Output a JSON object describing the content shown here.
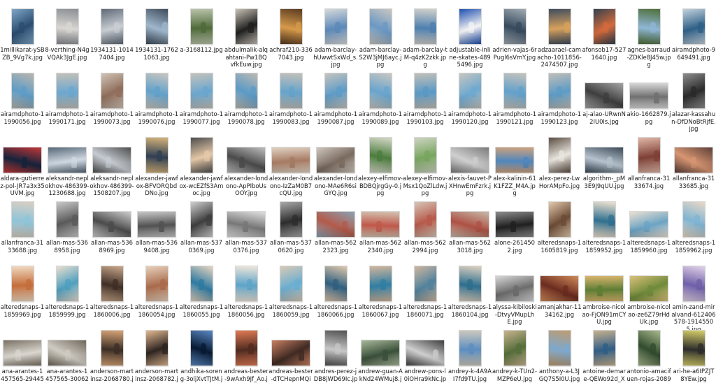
{
  "explorer": {
    "view": "large-icons",
    "files": [
      {
        "name": "1millikarat-ySBZB_9Vg7k.jpg",
        "orientation": "portrait",
        "palette": [
          "#2b4c6f",
          "#7fa7c8"
        ]
      },
      {
        "name": "8-verthing-N4gVQAk3JgE.jpg",
        "orientation": "portrait",
        "palette": [
          "#d9d7d2",
          "#8b8e94"
        ]
      },
      {
        "name": "1934131-10147404.jpg",
        "orientation": "portrait",
        "palette": [
          "#c9ced3",
          "#5f6a78"
        ]
      },
      {
        "name": "1934131-17621063.jpg",
        "orientation": "portrait",
        "palette": [
          "#9fb7cc",
          "#3e4c5b"
        ]
      },
      {
        "name": "a-3168112.jpg",
        "orientation": "portrait",
        "palette": [
          "#4e6a3a",
          "#b8c2a8"
        ]
      },
      {
        "name": "abdulmalik-alqahtani-Pw1BQvfkEuw.jpg",
        "orientation": "portrait",
        "palette": [
          "#1f1f1f",
          "#c9c2b6"
        ]
      },
      {
        "name": "achraf210-3367043.jpg",
        "orientation": "portrait",
        "palette": [
          "#d69a4a",
          "#5a3b22"
        ]
      },
      {
        "name": "adam-barclay-hUwwtSxWd_s.jpg",
        "orientation": "portrait",
        "palette": [
          "#5b88b8",
          "#d6d9db"
        ]
      },
      {
        "name": "adam-barclay-S2W3jMJ6ayc.jpg",
        "orientation": "portrait",
        "palette": [
          "#6b98c4",
          "#c9c7c0"
        ]
      },
      {
        "name": "adam-barclay-tM-q4zK2zkk.jpg",
        "orientation": "portrait",
        "palette": [
          "#4d7fb0",
          "#d1d0ca"
        ]
      },
      {
        "name": "adjustable-inline-skates-4895496.jpg",
        "orientation": "portrait",
        "palette": [
          "#f3f3f3",
          "#1f4fb0"
        ]
      },
      {
        "name": "adrien-vajas-6rPugl6sVmY.jpg",
        "orientation": "portrait",
        "palette": [
          "#364a5d",
          "#a0aab3"
        ]
      },
      {
        "name": "adzaarael-camacho-1011856-2474507.jpg",
        "orientation": "portrait",
        "palette": [
          "#d8a15c",
          "#3f4d5f"
        ]
      },
      {
        "name": "afonsob17-5271640.jpg",
        "orientation": "portrait",
        "palette": [
          "#d46a3c",
          "#31414f"
        ]
      },
      {
        "name": "agnes-barraud-ZDKle8J45w.jpg",
        "orientation": "portrait",
        "palette": [
          "#8fb6d6",
          "#4f6f39"
        ]
      },
      {
        "name": "airamdphoto-9649491.jpg",
        "orientation": "portrait",
        "palette": [
          "#2e5f87",
          "#c1d1dd"
        ]
      },
      {
        "name": "airamdphoto-11990056.jpg",
        "orientation": "portrait",
        "palette": [
          "#5f9cc6",
          "#b9b6ad"
        ]
      },
      {
        "name": "airamdphoto-11990171.jpg",
        "orientation": "portrait",
        "palette": [
          "#6ba7cf",
          "#c2c0b9"
        ]
      },
      {
        "name": "airamdphoto-11990073.jpg",
        "orientation": "portrait",
        "palette": [
          "#8f6d5a",
          "#d0c3b6"
        ]
      },
      {
        "name": "airamdphoto-11990076.jpg",
        "orientation": "portrait",
        "palette": [
          "#62a1cb",
          "#c8c6bf"
        ]
      },
      {
        "name": "airamdphoto-11990077.jpg",
        "orientation": "portrait",
        "palette": [
          "#6aa6ce",
          "#c4c2bb"
        ]
      },
      {
        "name": "airamdphoto-11990078.jpg",
        "orientation": "portrait",
        "palette": [
          "#5b9ac6",
          "#bdbab3"
        ]
      },
      {
        "name": "airamdphoto-11990083.jpg",
        "orientation": "portrait",
        "palette": [
          "#65a3cb",
          "#c2c0b9"
        ]
      },
      {
        "name": "airamdphoto-11990087.jpg",
        "orientation": "portrait",
        "palette": [
          "#5e9cc7",
          "#c6c4bd"
        ]
      },
      {
        "name": "airamdphoto-11990089.jpg",
        "orientation": "portrait",
        "palette": [
          "#68a4cd",
          "#c9c7c0"
        ]
      },
      {
        "name": "airamdphoto-11990103.jpg",
        "orientation": "portrait",
        "palette": [
          "#5a99c5",
          "#c1bfb8"
        ]
      },
      {
        "name": "airamdphoto-11990120.jpg",
        "orientation": "portrait",
        "palette": [
          "#6ea9d0",
          "#c7c5be"
        ]
      },
      {
        "name": "airamdphoto-11990121.jpg",
        "orientation": "portrait",
        "palette": [
          "#62a0ca",
          "#c5c3bc"
        ]
      },
      {
        "name": "airamdphoto-11990123.jpg",
        "orientation": "portrait",
        "palette": [
          "#5d9bc6",
          "#c0beb7"
        ]
      },
      {
        "name": "aj-alao-URwnN2IU0Is.jpg",
        "orientation": "landscape",
        "palette": [
          "#3e3e3e",
          "#a4a4a4"
        ]
      },
      {
        "name": "akio-1662879.jpg",
        "orientation": "landscape",
        "palette": [
          "#6f6f6f",
          "#d7d7d7"
        ]
      },
      {
        "name": "alazar-kassahun-DfDNoBtRjfE.jpg",
        "orientation": "portrait",
        "palette": [
          "#2a2a2a",
          "#8e8e8e"
        ]
      },
      {
        "name": "aldara-gutierrez-pol-JR7a3x35UVM.jpg",
        "orientation": "landscape",
        "palette": [
          "#14233b",
          "#c43838"
        ]
      },
      {
        "name": "aleksandr-neplokhov-486399-1230688.jpg",
        "orientation": "landscape",
        "palette": [
          "#cfd8e1",
          "#566777"
        ]
      },
      {
        "name": "aleksandr-neplokhov-486399-1508207.jpg",
        "orientation": "landscape",
        "palette": [
          "#c5cbd1",
          "#4e4e4e"
        ]
      },
      {
        "name": "alexander-jawfox-BFVORQbdDNo.jpg",
        "orientation": "portrait",
        "palette": [
          "#2f3f53",
          "#d7b47a"
        ]
      },
      {
        "name": "alexander-jawfox-wcEZfS3Amoc.jpg",
        "orientation": "portrait",
        "palette": [
          "#e6c9a8",
          "#4d4d4d"
        ]
      },
      {
        "name": "alexander-londono-ApPIboUsOOY.jpg",
        "orientation": "landscape",
        "palette": [
          "#4a4a4a",
          "#bdbdbd"
        ]
      },
      {
        "name": "alexander-londono-IzZaM0B7cQU.jpg",
        "orientation": "landscape",
        "palette": [
          "#a67a62",
          "#e0d2c3"
        ]
      },
      {
        "name": "alexander-londono-MAe6R6siGYQ.jpg",
        "orientation": "landscape",
        "palette": [
          "#7a6a5f",
          "#cfc7be"
        ]
      },
      {
        "name": "alexey-elfimov-BDBQjrgGy-0.jpg",
        "orientation": "portrait",
        "palette": [
          "#4b7c3d",
          "#d6d9c9"
        ]
      },
      {
        "name": "alexey-elfimov-Msx1QoZlLdw.jpg",
        "orientation": "portrait",
        "palette": [
          "#78a65e",
          "#cdd4c2"
        ]
      },
      {
        "name": "alexis-fauvet-PXHnwEmFzrk.jpg",
        "orientation": "landscape",
        "palette": [
          "#cfcfcf",
          "#7a7a7a"
        ]
      },
      {
        "name": "alex-kalinin-61K1FZZ_M4A.jpg",
        "orientation": "landscape",
        "palette": [
          "#4f86bd",
          "#cfa27d"
        ]
      },
      {
        "name": "alex-perez-LwHorAMpFo.jpg",
        "orientation": "portrait",
        "palette": [
          "#e9e6df",
          "#5b4d42"
        ]
      },
      {
        "name": "algorithm-_pM3E9J9qUU.jpg",
        "orientation": "landscape",
        "palette": [
          "#b6c3ce",
          "#3b4a57"
        ]
      },
      {
        "name": "allanfranca-3133674.jpg",
        "orientation": "portrait",
        "palette": [
          "#7d3f35",
          "#e0b7a7"
        ]
      },
      {
        "name": "allanfranca-3133685.jpg",
        "orientation": "landscape",
        "palette": [
          "#d79572",
          "#5c3f38"
        ]
      },
      {
        "name": "allanfranca-3133688.jpg",
        "orientation": "portrait",
        "palette": [
          "#8fc4d9",
          "#d8cfc2"
        ]
      },
      {
        "name": "allan-mas-5368958.jpg",
        "orientation": "portrait",
        "palette": [
          "#5a5a5a",
          "#c9c9c9"
        ]
      },
      {
        "name": "allan-mas-5368969.jpg",
        "orientation": "landscape",
        "palette": [
          "#4b4b4b",
          "#cdcdcd"
        ]
      },
      {
        "name": "allan-mas-5369408.jpg",
        "orientation": "landscape",
        "palette": [
          "#515151",
          "#c6c6c6"
        ]
      },
      {
        "name": "allan-mas-5370369.jpg",
        "orientation": "portrait",
        "palette": [
          "#3d3d3d",
          "#d0d0d0"
        ]
      },
      {
        "name": "allan-mas-5370376.jpg",
        "orientation": "landscape",
        "palette": [
          "#777777",
          "#e0e0e0"
        ]
      },
      {
        "name": "allan-mas-5370620.jpg",
        "orientation": "portrait",
        "palette": [
          "#2c2c2c",
          "#a8a8a8"
        ]
      },
      {
        "name": "allan-mas-5622323.jpg",
        "orientation": "landscape",
        "palette": [
          "#b35a4a",
          "#8aa3b5"
        ]
      },
      {
        "name": "allan-mas-5622340.jpg",
        "orientation": "landscape",
        "palette": [
          "#c0584a",
          "#d3c3b0"
        ]
      },
      {
        "name": "allan-mas-5622994.jpg",
        "orientation": "portrait",
        "palette": [
          "#b75a4b",
          "#d6c7b8"
        ]
      },
      {
        "name": "allan-mas-5623018.jpg",
        "orientation": "landscape",
        "palette": [
          "#ad5144",
          "#c8b9aa"
        ]
      },
      {
        "name": "alone-2614502.jpg",
        "orientation": "landscape",
        "palette": [
          "#1f1f1f",
          "#8c8c8c"
        ]
      },
      {
        "name": "alteredsnaps-11605819.jpg",
        "orientation": "portrait",
        "palette": [
          "#6b4b35",
          "#e3c9ae"
        ]
      },
      {
        "name": "alteredsnaps-11859952.jpg",
        "orientation": "portrait",
        "palette": [
          "#2f6f8f",
          "#f0e2cf"
        ]
      },
      {
        "name": "alteredsnaps-11859960.jpg",
        "orientation": "landscape",
        "palette": [
          "#6ba3c4",
          "#ece1d1"
        ]
      },
      {
        "name": "alteredsnaps-11859962.jpg",
        "orientation": "portrait",
        "palette": [
          "#7fb4d3",
          "#ead9c5"
        ]
      },
      {
        "name": "alteredsnaps-11859969.jpg",
        "orientation": "portrait",
        "palette": [
          "#c46d3a",
          "#f0d9c0"
        ]
      },
      {
        "name": "alteredsnaps-11859999.jpg",
        "orientation": "portrait",
        "palette": [
          "#4f9fbf",
          "#eadfd0"
        ]
      },
      {
        "name": "alteredsnaps-11860006.jpg",
        "orientation": "portrait",
        "palette": [
          "#3f2e26",
          "#c9a88a"
        ]
      },
      {
        "name": "alteredsnaps-11860054.jpg",
        "orientation": "portrait",
        "palette": [
          "#a86a4a",
          "#e7d0bb"
        ]
      },
      {
        "name": "alteredsnaps-11860055.jpg",
        "orientation": "portrait",
        "palette": [
          "#2e7aa1",
          "#e8d5bf"
        ]
      },
      {
        "name": "alteredsnaps-11860056.jpg",
        "orientation": "portrait",
        "palette": [
          "#5ca3c8",
          "#efe6da"
        ]
      },
      {
        "name": "alteredsnaps-11860059.jpg",
        "orientation": "portrait",
        "palette": [
          "#6aaed1",
          "#d9c9b5"
        ]
      },
      {
        "name": "alteredsnaps-11860066.jpg",
        "orientation": "portrait",
        "palette": [
          "#2f5f7f",
          "#e0c8ad"
        ]
      },
      {
        "name": "alteredsnaps-11860067.jpg",
        "orientation": "portrait",
        "palette": [
          "#2f7ea3",
          "#d2b59b"
        ]
      },
      {
        "name": "alteredsnaps-11860071.jpg",
        "orientation": "portrait",
        "palette": [
          "#52829c",
          "#cfb79f"
        ]
      },
      {
        "name": "alteredsnaps-11860104.jpg",
        "orientation": "portrait",
        "palette": [
          "#2d6e8e",
          "#dfd1c0"
        ]
      },
      {
        "name": "alyssa-kibiloski-DtvyVMupLhE.jpg",
        "orientation": "landscape",
        "palette": [
          "#6b6b6b",
          "#d8d8d8"
        ]
      },
      {
        "name": "amanjakhar-1134162.jpg",
        "orientation": "landscape",
        "palette": [
          "#6a2b1f",
          "#d18b5a"
        ]
      },
      {
        "name": "ambroise-nicolao-FjON91mCYU.jpg",
        "orientation": "landscape",
        "palette": [
          "#5d7d34",
          "#d9b56d"
        ]
      },
      {
        "name": "ambroise-nicolao-ze6Z79rHdUk.jpg",
        "orientation": "landscape",
        "palette": [
          "#6e8a3a",
          "#dcc07a"
        ]
      },
      {
        "name": "amin-zand-miralvand-612406578-19145505.jpg",
        "orientation": "portrait",
        "palette": [
          "#6d5fa8",
          "#e3d3e8"
        ]
      },
      {
        "name": "ana-arantes-1457565-2944542.jpg",
        "orientation": "landscape",
        "palette": [
          "#d9d6cf",
          "#7a7163"
        ]
      },
      {
        "name": "ana-arantes-1457565-3006223.jpg",
        "orientation": "landscape",
        "palette": [
          "#cfcbc3",
          "#6f665a"
        ]
      },
      {
        "name": "anderson-martinsz-2068780.jpg",
        "orientation": "portrait",
        "palette": [
          "#3b2d25",
          "#d7a476"
        ]
      },
      {
        "name": "anderson-martinsz-2068782.jpg",
        "orientation": "portrait",
        "palette": [
          "#2d2420",
          "#e3b991"
        ]
      },
      {
        "name": "andhika-soreng-3oljXvtTJtM.jpg",
        "orientation": "portrait",
        "palette": [
          "#081a33",
          "#5a88c3"
        ]
      },
      {
        "name": "andreas-bester-9wAxh9Jf_Ao.jpg",
        "orientation": "portrait",
        "palette": [
          "#4f2a1f",
          "#e07a55"
        ]
      },
      {
        "name": "andreas-bester-dTCHepnMQiQ.jpg",
        "orientation": "landscape",
        "palette": [
          "#3f2a23",
          "#c98062"
        ]
      },
      {
        "name": "andres-perez-jDB8jWD69Ic.jpg",
        "orientation": "portrait",
        "palette": [
          "#c7c7c7",
          "#505050"
        ]
      },
      {
        "name": "andrew-guan-AkNd24WMuj8.jpg",
        "orientation": "landscape",
        "palette": [
          "#3a4f39",
          "#a7b89a"
        ]
      },
      {
        "name": "andrew-pons-l0iOHra9kNc.jpg",
        "orientation": "landscape",
        "palette": [
          "#cfcfcf",
          "#3e3e3e"
        ]
      },
      {
        "name": "andrey-k-4A9AI7fd9TU.jpg",
        "orientation": "portrait",
        "palette": [
          "#5c8ec0",
          "#cbc7bd"
        ]
      },
      {
        "name": "andrey-k-TUn2-MZP6eU.jpg",
        "orientation": "portrait",
        "palette": [
          "#556d3a",
          "#c8b48f"
        ]
      },
      {
        "name": "anthony-a-L3JGQ7S5I0U.jpg",
        "orientation": "portrait",
        "palette": [
          "#7da8cc",
          "#c09b6f"
        ]
      },
      {
        "name": "antoine-demare-QEWo92d_X3w.jpg",
        "orientation": "portrait",
        "palette": [
          "#2f5d86",
          "#c7b08e"
        ]
      },
      {
        "name": "antonio-amacifuen-rojas-208946592-12503159.jpg",
        "orientation": "portrait",
        "palette": [
          "#314a2e",
          "#a8b98c"
        ]
      },
      {
        "name": "ari-he-a6IPZJT8YEw.jpg",
        "orientation": "portrait",
        "palette": [
          "#2b2b2b",
          "#d7cf69"
        ]
      }
    ]
  }
}
